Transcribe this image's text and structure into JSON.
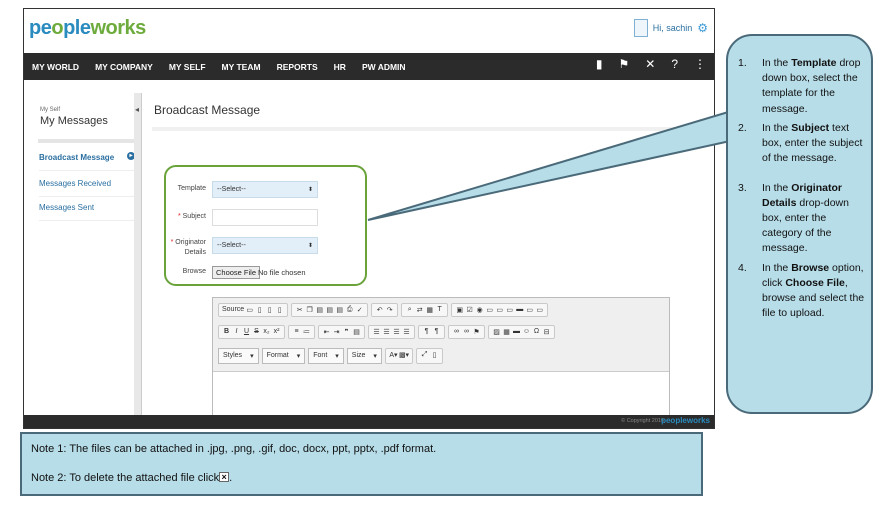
{
  "app": {
    "logo_part1": "pe",
    "logo_o": "o",
    "logo_part2": "ple",
    "logo_part3": "works",
    "user_greeting": "Hi, sachin"
  },
  "nav": {
    "items": [
      "MY WORLD",
      "MY COMPANY",
      "MY SELF",
      "MY TEAM",
      "REPORTS",
      "HR",
      "PW ADMIN"
    ],
    "icons": [
      "book-icon",
      "flag-icon",
      "tools-icon",
      "help-icon",
      "menu-icon"
    ]
  },
  "sidebar": {
    "breadcrumb": "My Self",
    "title": "My Messages",
    "items": [
      "Broadcast Message",
      "Messages Received",
      "Messages Sent"
    ]
  },
  "main": {
    "title": "Broadcast Message"
  },
  "form": {
    "template_label": "Template",
    "template_value": "--Select--",
    "subject_label": "Subject",
    "subject_value": "",
    "originator_label_1": "Originator",
    "originator_label_2": "Details",
    "originator_value": "--Select--",
    "browse_label": "Browse",
    "choose_file": "Choose File",
    "no_file": "No file chosen",
    "required_mark": "*"
  },
  "editor": {
    "source_label": "Source",
    "styles_label": "Styles",
    "format_label": "Format",
    "font_label": "Font",
    "size_label": "Size",
    "bold": "B",
    "italic": "I",
    "underline": "U",
    "strike": "S",
    "subscript": "x₂",
    "superscript": "x²"
  },
  "footer": {
    "copyright": "© Copyright 2016",
    "logo": "peopleworks"
  },
  "callout": {
    "steps": [
      {
        "num": "1.",
        "pre": "In the ",
        "bold": "Template",
        "post": " drop down box, select the template for the message."
      },
      {
        "num": "2.",
        "pre": "In the ",
        "bold": "Subject",
        "post": " text box, enter the subject of the message."
      },
      {
        "num": "3.",
        "pre": "In the ",
        "bold": "Originator Details",
        "post": " drop-down box, enter the category of the message."
      },
      {
        "num": "4.",
        "pre": "In the ",
        "bold": "Browse",
        "post": " option, click ",
        "bold2": "Choose File",
        "post2": ", browse and select the file to upload."
      }
    ]
  },
  "notes": {
    "note1": "Note 1: The files can be attached in .jpg, .png, .gif, doc, docx, ppt, pptx, .pdf format.",
    "note2": "Note 2: To delete the attached file click",
    "note2_end": ".",
    "delete_icon": "×"
  },
  "colors": {
    "nav_bg": "#2b2b2b",
    "link_blue": "#2a6fa0",
    "callout_bg": "#b7dde8",
    "highlight_green": "#6aa33a"
  }
}
